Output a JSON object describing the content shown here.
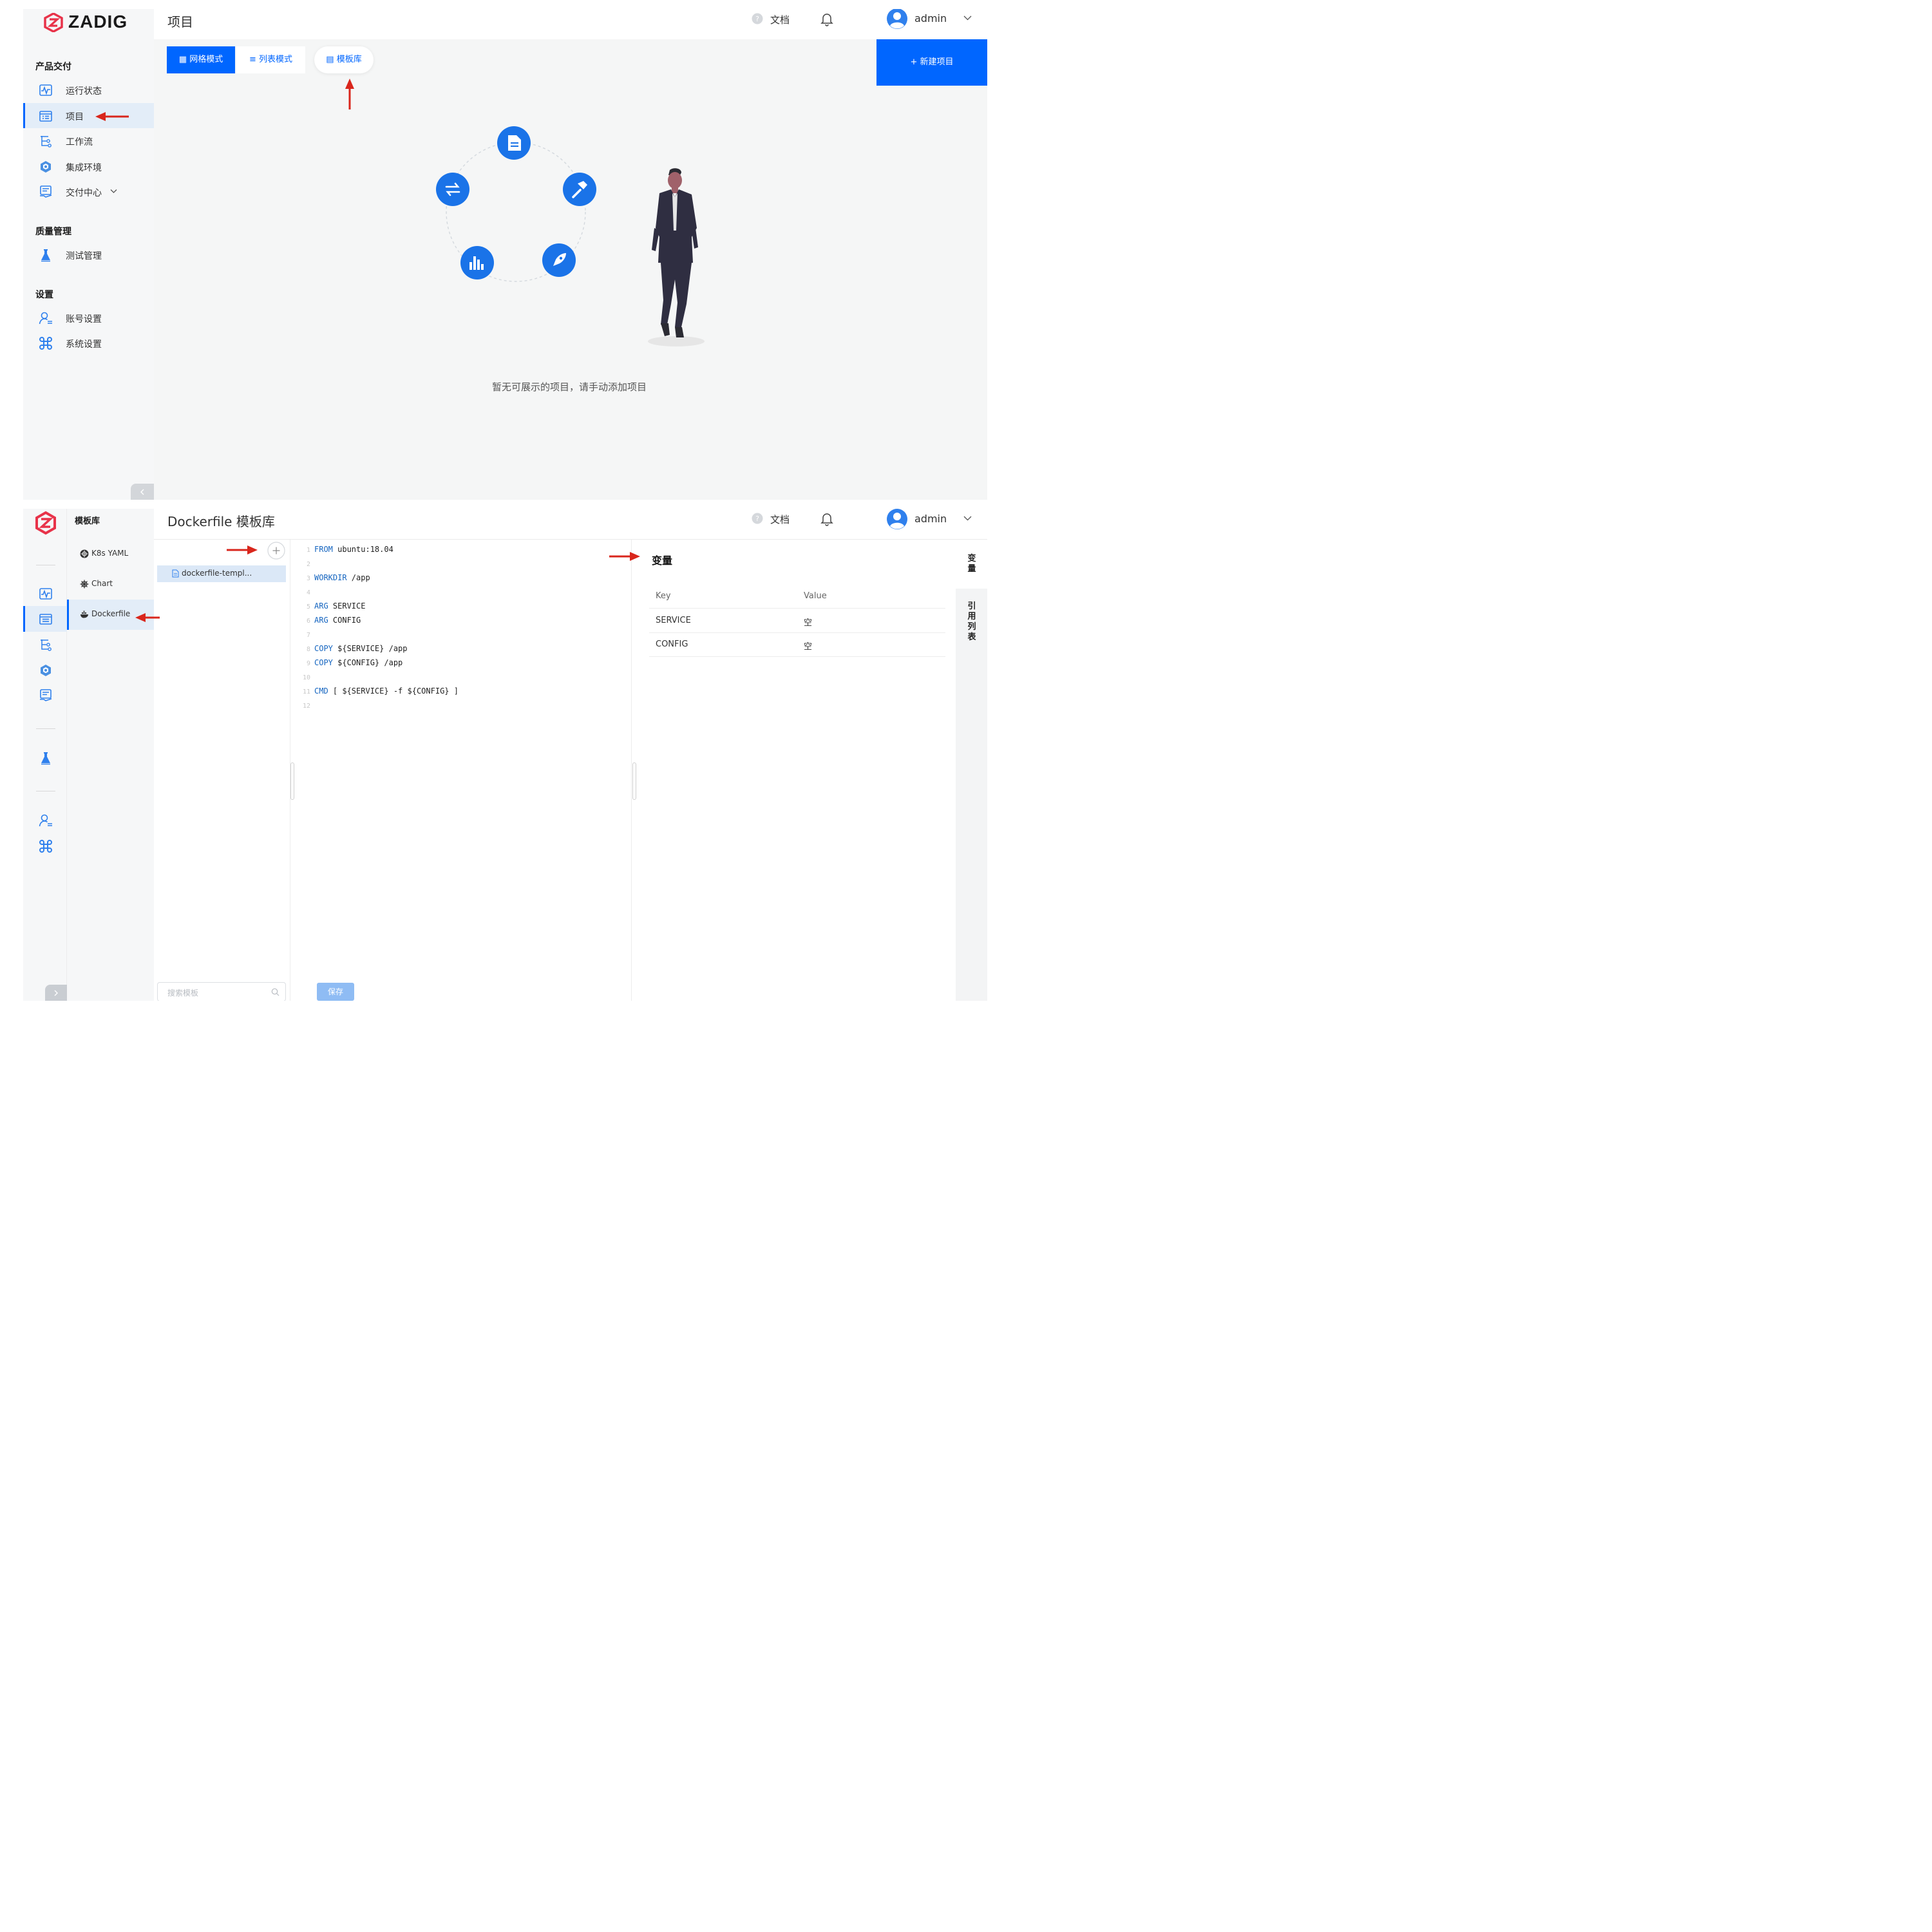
{
  "panel1": {
    "logo_text": "ZADIG",
    "header": {
      "title": "项目",
      "docs_label": "文档",
      "username": "admin"
    },
    "sidebar": {
      "sections": [
        {
          "title": "产品交付",
          "items": [
            {
              "label": "运行状态",
              "icon": "activity-icon"
            },
            {
              "label": "项目",
              "icon": "project-list-icon",
              "active": true
            },
            {
              "label": "工作流",
              "icon": "workflow-tree-icon"
            },
            {
              "label": "集成环境",
              "icon": "environment-cube-icon"
            },
            {
              "label": "交付中心",
              "icon": "delivery-center-icon",
              "has_dropdown": true
            }
          ]
        },
        {
          "title": "质量管理",
          "items": [
            {
              "label": "测试管理",
              "icon": "flask-icon"
            }
          ]
        },
        {
          "title": "设置",
          "items": [
            {
              "label": "账号设置",
              "icon": "user-settings-icon"
            },
            {
              "label": "系统设置",
              "icon": "command-icon"
            }
          ]
        }
      ]
    },
    "tabs": [
      {
        "label": "网格模式",
        "icon": "grid-icon",
        "active": true
      },
      {
        "label": "列表模式",
        "icon": "list-icon"
      },
      {
        "label": "模板库",
        "icon": "template-icon"
      }
    ],
    "new_project_label": "+ 新建项目",
    "empty_message": "暂无可展示的项目，请手动添加项目"
  },
  "panel2": {
    "sub_nav_title": "模板库",
    "sub_nav_items": [
      {
        "label": "K8s YAML",
        "icon": "kubernetes-icon"
      },
      {
        "label": "Chart",
        "icon": "helm-icon"
      },
      {
        "label": "Dockerfile",
        "icon": "docker-icon",
        "active": true
      }
    ],
    "header": {
      "title": "Dockerfile 模板库",
      "docs_label": "文档",
      "username": "admin"
    },
    "template_list": [
      {
        "name": "dockerfile-templ...",
        "active": true
      }
    ],
    "search_placeholder": "搜索模板",
    "code_lines": [
      {
        "n": "1",
        "kw": "FROM",
        "rest": " ubuntu:18.04"
      },
      {
        "n": "2",
        "kw": "",
        "rest": ""
      },
      {
        "n": "3",
        "kw": "WORKDIR",
        "rest": " /app"
      },
      {
        "n": "4",
        "kw": "",
        "rest": ""
      },
      {
        "n": "5",
        "kw": "ARG",
        "rest": " SERVICE"
      },
      {
        "n": "6",
        "kw": "ARG",
        "rest": " CONFIG"
      },
      {
        "n": "7",
        "kw": "",
        "rest": ""
      },
      {
        "n": "8",
        "kw": "COPY",
        "rest": " ${SERVICE} /app"
      },
      {
        "n": "9",
        "kw": "COPY",
        "rest": " ${CONFIG} /app"
      },
      {
        "n": "10",
        "kw": "",
        "rest": ""
      },
      {
        "n": "11",
        "kw": "CMD",
        "rest": " [ ${SERVICE} -f ${CONFIG} ]"
      },
      {
        "n": "12",
        "kw": "",
        "rest": ""
      }
    ],
    "save_label": "保存",
    "variables": {
      "title": "变量",
      "col_key": "Key",
      "col_value": "Value",
      "rows": [
        {
          "key": "SERVICE",
          "value": "空"
        },
        {
          "key": "CONFIG",
          "value": "空"
        }
      ]
    },
    "right_tabs": [
      {
        "label": "变量"
      },
      {
        "label": "引用列表"
      }
    ]
  },
  "colors": {
    "primary": "#0066ff",
    "annotation_arrow": "#d9261c",
    "brand_logo": "#e8334a"
  }
}
